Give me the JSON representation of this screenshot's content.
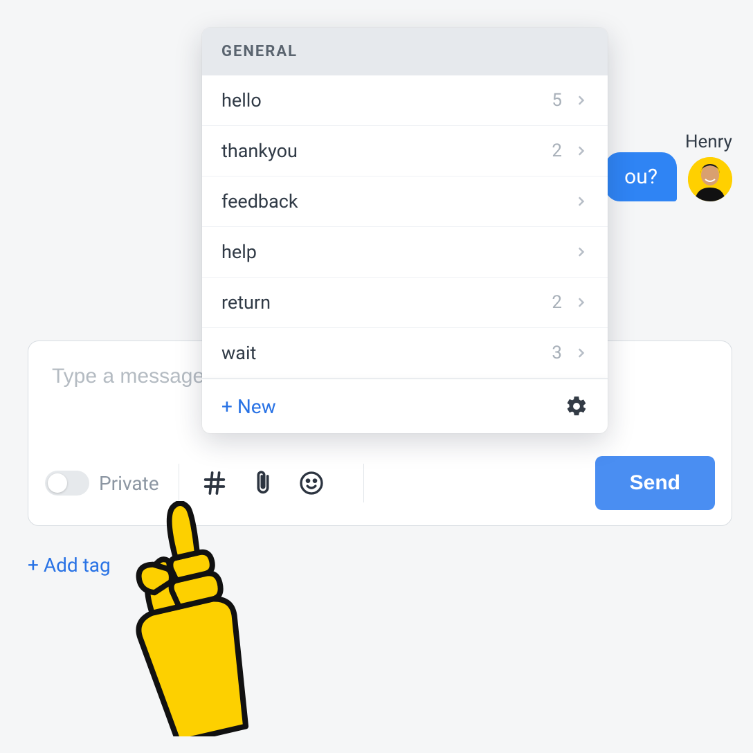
{
  "chat": {
    "sender_name": "Henry",
    "bubble_text": "ou?"
  },
  "composer": {
    "placeholder": "Type a message",
    "private_label": "Private",
    "send_label": "Send"
  },
  "add_tag_label": "+ Add tag",
  "popover": {
    "header": "GENERAL",
    "items": [
      {
        "label": "hello",
        "count": "5"
      },
      {
        "label": "thankyou",
        "count": "2"
      },
      {
        "label": "feedback",
        "count": ""
      },
      {
        "label": "help",
        "count": ""
      },
      {
        "label": "return",
        "count": "2"
      },
      {
        "label": "wait",
        "count": "3"
      }
    ],
    "new_label": "+ New"
  }
}
